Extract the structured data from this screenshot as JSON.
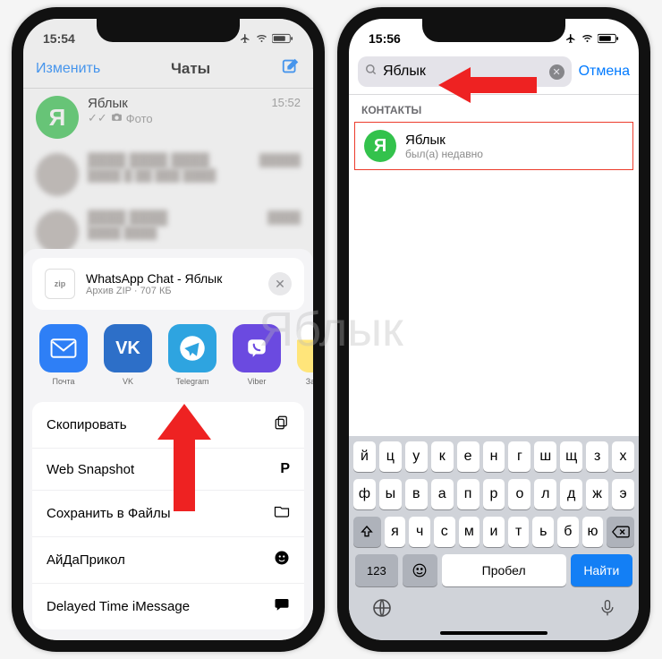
{
  "phone1": {
    "status": {
      "time": "15:54"
    },
    "nav": {
      "edit": "Изменить",
      "title": "Чаты"
    },
    "chat": {
      "name": "Яблык",
      "message": "Фото",
      "time": "15:52",
      "avatar_letter": "Я"
    },
    "share": {
      "file_title": "WhatsApp Chat - Яблык",
      "file_sub": "Архив ZIP · 707 КБ",
      "apps": [
        {
          "label": "Почта"
        },
        {
          "label": "VK",
          "mono": "VK"
        },
        {
          "label": "Telegram"
        },
        {
          "label": "Viber"
        },
        {
          "label": "Заметки"
        }
      ],
      "actions": [
        {
          "label": "Скопировать",
          "icon": "copy"
        },
        {
          "label": "Web Snapshot",
          "icon": "p"
        },
        {
          "label": "Сохранить в Файлы",
          "icon": "folder"
        },
        {
          "label": "АйДаПрикол",
          "icon": "smile"
        },
        {
          "label": "Delayed Time iMessage",
          "icon": "chat"
        }
      ]
    }
  },
  "phone2": {
    "status": {
      "time": "15:56"
    },
    "search": {
      "query": "Яблык",
      "cancel": "Отмена"
    },
    "section": "КОНТАКТЫ",
    "result": {
      "name": "Яблык",
      "sub": "был(а) недавно",
      "avatar_letter": "Я"
    },
    "keyboard": {
      "row1": [
        "й",
        "ц",
        "у",
        "к",
        "е",
        "н",
        "г",
        "ш",
        "щ",
        "з",
        "х"
      ],
      "row2": [
        "ф",
        "ы",
        "в",
        "а",
        "п",
        "р",
        "о",
        "л",
        "д",
        "ж",
        "э"
      ],
      "row3_shift": "⇧",
      "row3": [
        "я",
        "ч",
        "с",
        "м",
        "и",
        "т",
        "ь",
        "б",
        "ю"
      ],
      "num": "123",
      "emoji": "☺",
      "space": "Пробел",
      "find": "Найти"
    }
  },
  "watermark": "Яблык"
}
